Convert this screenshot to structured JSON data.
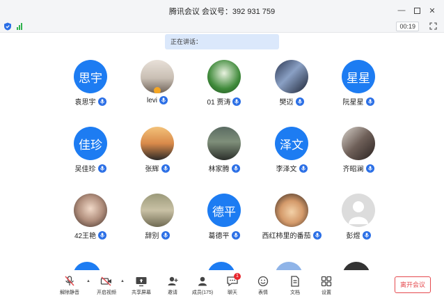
{
  "window": {
    "title": "腾讯会议 会议号：392 931 759",
    "controls": [
      "minimize",
      "maximize",
      "close"
    ]
  },
  "statusbar": {
    "timer": "00:19"
  },
  "speaking": {
    "label": "正在讲话："
  },
  "participants": [
    {
      "name": "袁思宇",
      "avatar_text": "思宇",
      "avatar_type": "text"
    },
    {
      "name": "levi",
      "avatar_text": "",
      "avatar_type": "photo",
      "host": true
    },
    {
      "name": "01 贾涛",
      "avatar_text": "",
      "avatar_type": "photo"
    },
    {
      "name": "樊迈",
      "avatar_text": "",
      "avatar_type": "photo"
    },
    {
      "name": "阮星星",
      "avatar_text": "星星",
      "avatar_type": "text"
    },
    {
      "name": "吴佳珍",
      "avatar_text": "佳珍",
      "avatar_type": "text"
    },
    {
      "name": "张辉",
      "avatar_text": "",
      "avatar_type": "photo"
    },
    {
      "name": "林家腾",
      "avatar_text": "",
      "avatar_type": "photo"
    },
    {
      "name": "李泽文",
      "avatar_text": "泽文",
      "avatar_type": "text"
    },
    {
      "name": "齐昭澜",
      "avatar_text": "",
      "avatar_type": "photo"
    },
    {
      "name": "42王艳",
      "avatar_text": "",
      "avatar_type": "photo"
    },
    {
      "name": "辞别",
      "avatar_text": "",
      "avatar_type": "photo"
    },
    {
      "name": "葛德平",
      "avatar_text": "德平",
      "avatar_type": "text"
    },
    {
      "name": "西红柿里的番茄",
      "avatar_text": "",
      "avatar_type": "photo"
    },
    {
      "name": "彭煜",
      "avatar_text": "",
      "avatar_type": "default"
    }
  ],
  "toolbar": {
    "unmute": "解除静音",
    "start_video": "开启视频",
    "share_screen": "共享屏幕",
    "invite": "邀请",
    "members": "成员(175)",
    "chat": "聊天",
    "chat_badge": "1",
    "reactions": "表情",
    "docs": "文档",
    "settings": "设置",
    "leave": "离开会议"
  },
  "colors": {
    "accent": "#1d7cf2",
    "danger": "#e5484d",
    "signal": "#2fb24d"
  }
}
